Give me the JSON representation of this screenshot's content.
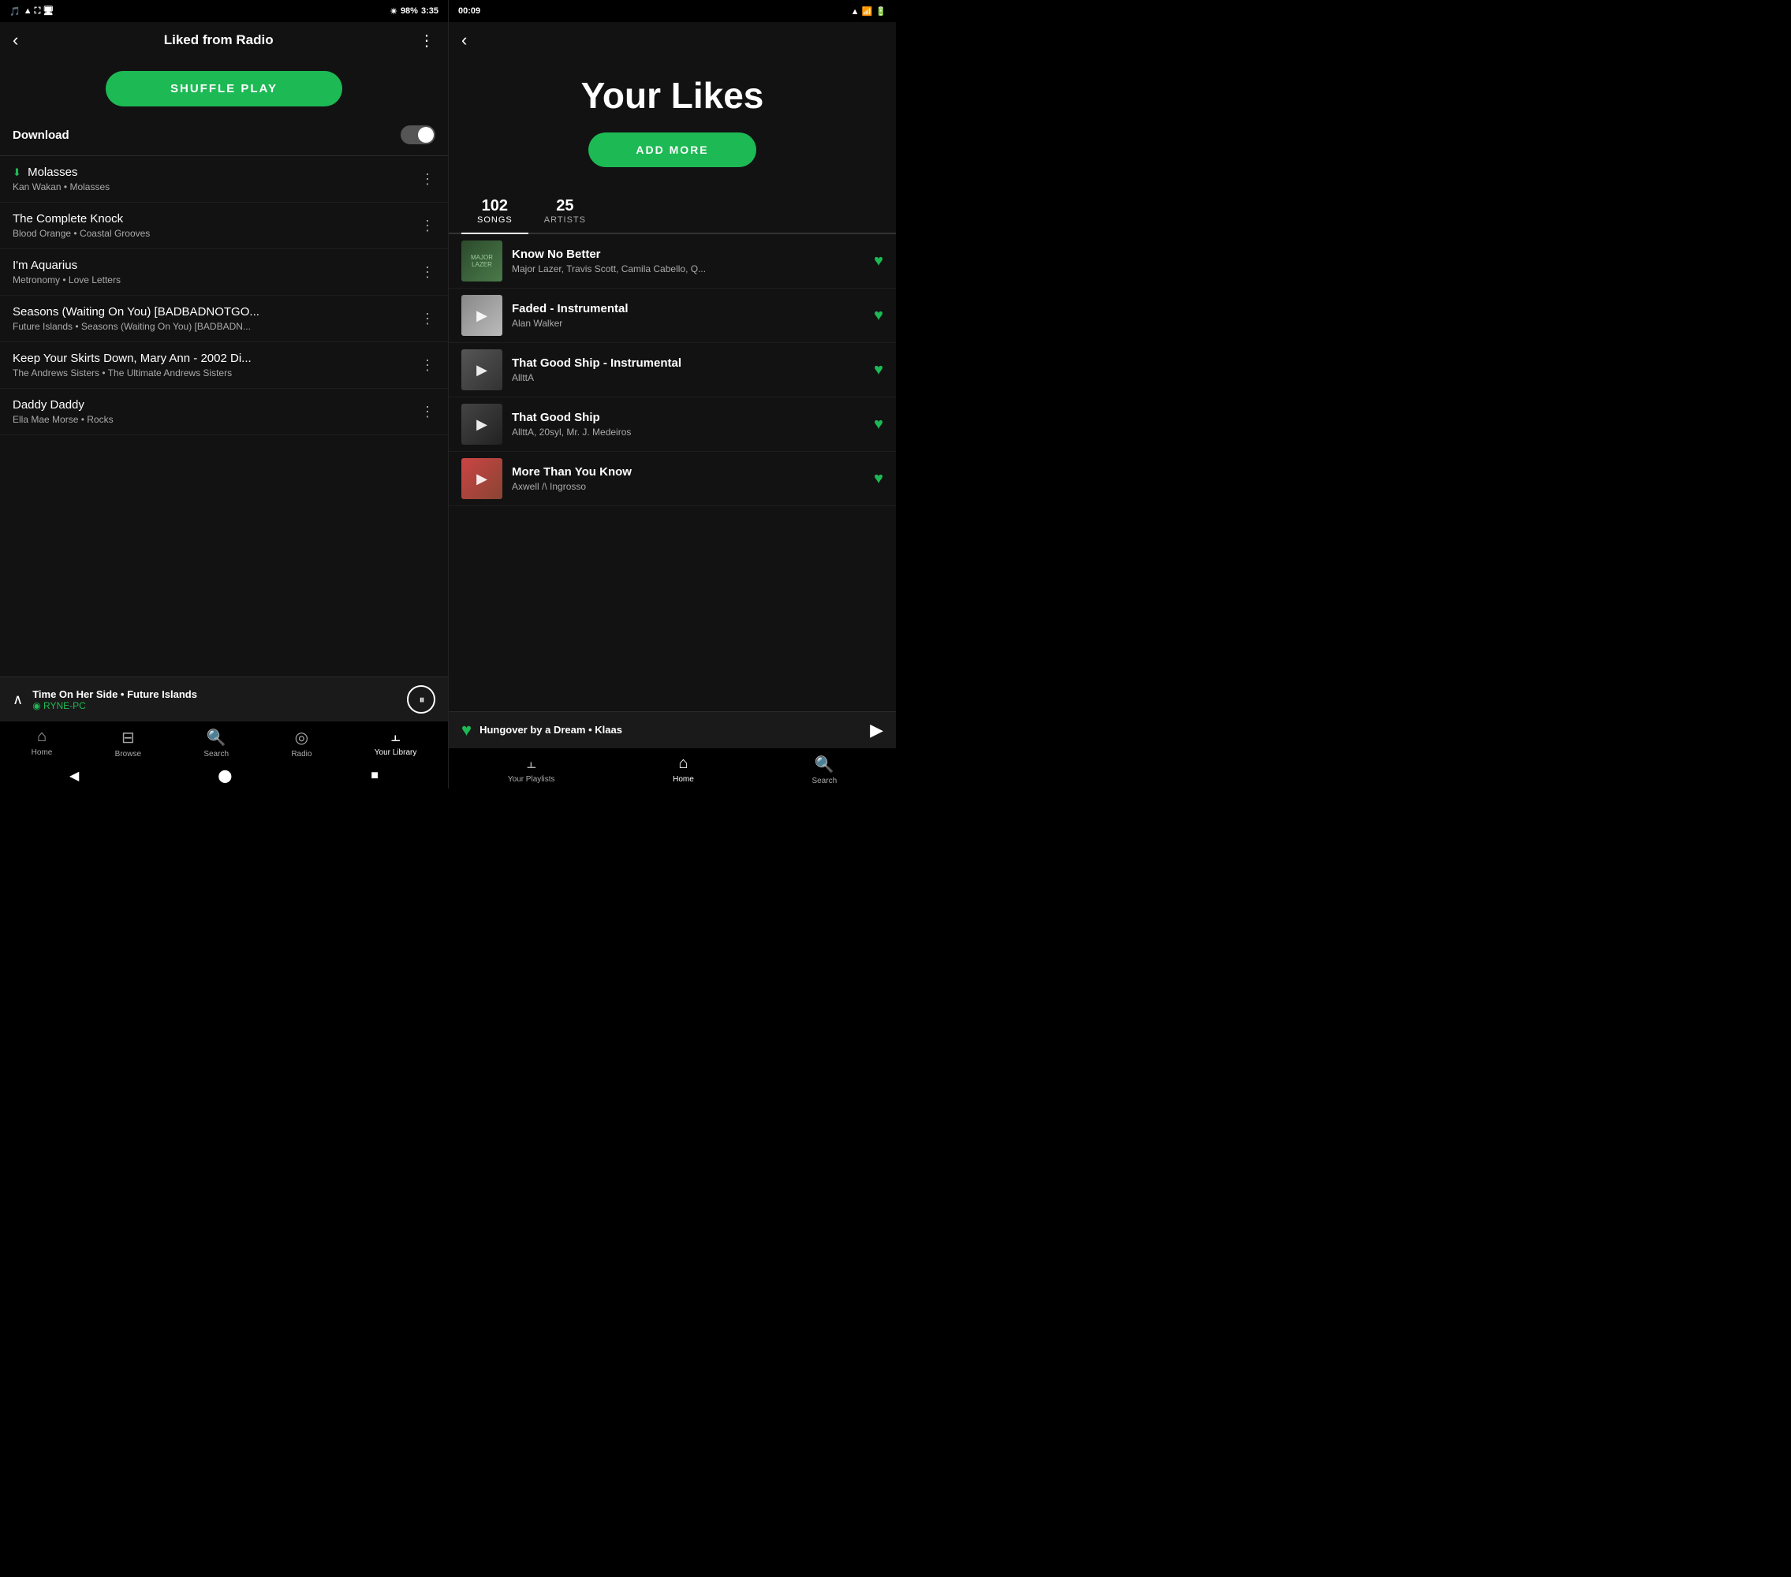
{
  "left": {
    "status": {
      "time": "3:35",
      "battery": "98%"
    },
    "header": {
      "title": "Liked from Radio",
      "back_label": "‹",
      "more_label": "⋮"
    },
    "shuffle_btn": "SHUFFLE PLAY",
    "download": {
      "label": "Download"
    },
    "tracks": [
      {
        "name": "Molasses",
        "artist": "Kan Wakan",
        "album": "Molasses",
        "downloaded": true
      },
      {
        "name": "The Complete Knock",
        "artist": "Blood Orange",
        "album": "Coastal Grooves",
        "downloaded": false
      },
      {
        "name": "I'm Aquarius",
        "artist": "Metronomy",
        "album": "Love Letters",
        "downloaded": false
      },
      {
        "name": "Seasons (Waiting On You) [BADBADNOTGO...",
        "artist": "Future Islands",
        "album": "Seasons (Waiting On You) [BADBADN...",
        "downloaded": false
      },
      {
        "name": "Keep Your Skirts Down, Mary Ann - 2002 Di...",
        "artist": "The Andrews Sisters",
        "album": "The Ultimate Andrews Sisters",
        "downloaded": false
      },
      {
        "name": "Daddy Daddy",
        "artist": "Ella Mae Morse",
        "album": "Rocks",
        "downloaded": false
      }
    ],
    "now_playing": {
      "title": "Time On Her Side • Future Islands",
      "device": "RYNE-PC"
    },
    "nav": [
      {
        "label": "Home",
        "icon": "⌂",
        "active": false
      },
      {
        "label": "Browse",
        "icon": "⊟",
        "active": false
      },
      {
        "label": "Search",
        "icon": "🔍",
        "active": false
      },
      {
        "label": "Radio",
        "icon": "◎",
        "active": false
      },
      {
        "label": "Your Library",
        "icon": "|||",
        "active": true
      }
    ]
  },
  "right": {
    "status": {
      "time": "00:09"
    },
    "title": "Your Likes",
    "add_more_btn": "ADD MORE",
    "stats": {
      "songs_count": "102",
      "songs_label": "SONGS",
      "artists_count": "25",
      "artists_label": "ARTISTS"
    },
    "songs": [
      {
        "name": "Know No Better",
        "artist": "Major Lazer, Travis Scott, Camila Cabello, Q...",
        "thumb_class": "thumb-1",
        "thumb_text": "MAJOR LAZER"
      },
      {
        "name": "Faded - Instrumental",
        "artist": "Alan Walker",
        "thumb_class": "thumb-2",
        "thumb_text": ""
      },
      {
        "name": "That Good Ship - Instrumental",
        "artist": "AllttA",
        "thumb_class": "thumb-3",
        "thumb_text": ""
      },
      {
        "name": "That Good Ship",
        "artist": "AllttA, 20syl, Mr. J. Medeiros",
        "thumb_class": "thumb-4",
        "thumb_text": ""
      },
      {
        "name": "More Than You Know",
        "artist": "Axwell /\\ Ingrosso",
        "thumb_class": "thumb-5",
        "thumb_text": ""
      }
    ],
    "mini_player": {
      "title": "Hungover by a Dream",
      "artist": "Klaas"
    },
    "nav": [
      {
        "label": "Your Playlists",
        "icon": "|||",
        "active": false
      },
      {
        "label": "Home",
        "icon": "⌂",
        "active": true
      },
      {
        "label": "Search",
        "icon": "🔍",
        "active": false
      }
    ]
  }
}
